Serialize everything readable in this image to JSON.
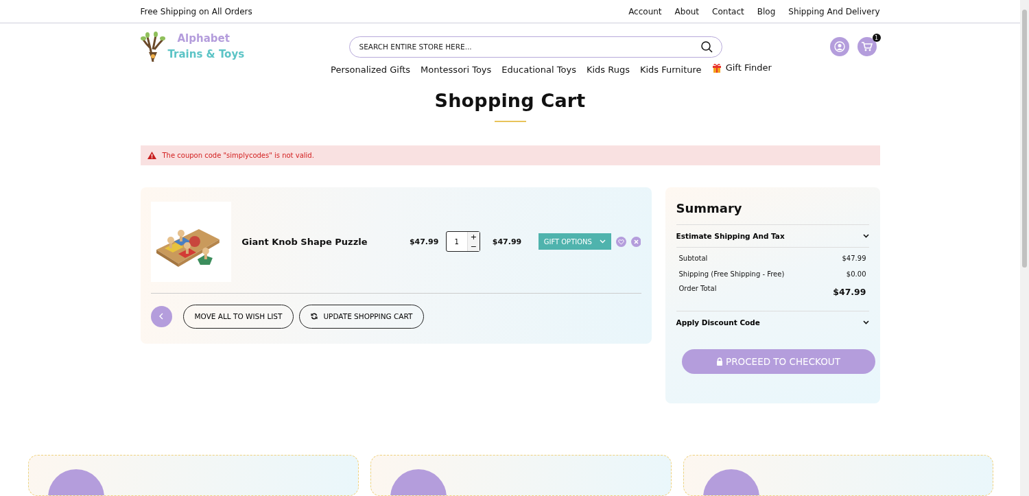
{
  "top_bar": {
    "promo": "Free Shipping on All Orders",
    "links": [
      "Account",
      "About",
      "Contact",
      "Blog",
      "Shipping And Delivery"
    ]
  },
  "header": {
    "logo": {
      "line1": "Alphabet",
      "line2": "Trains & Toys"
    },
    "search": {
      "placeholder": "SEARCH ENTIRE STORE HERE..."
    },
    "cart_count": "1"
  },
  "nav": [
    {
      "label": "Personalized Gifts",
      "kind": "plain"
    },
    {
      "label": "Montessori Toys",
      "kind": "plain"
    },
    {
      "label": "Educational Toys",
      "kind": "plain"
    },
    {
      "label": "Kids Rugs",
      "kind": "plain"
    },
    {
      "label": "Kids Furniture",
      "kind": "plain"
    },
    {
      "label": "Gift Finder",
      "kind": "gift"
    }
  ],
  "page_title": "Shopping Cart",
  "alert": "The coupon code \"simplycodes\" is not valid.",
  "cart": {
    "items": [
      {
        "name": "Giant Knob Shape Puzzle",
        "price": "$47.99",
        "qty": "1",
        "increase": "+",
        "decrease": "−",
        "subtotal": "$47.99",
        "gift_button": "GIFT OPTIONS"
      }
    ],
    "actions": [
      "MOVE ALL TO WISH LIST",
      "UPDATE SHOPPING CART"
    ]
  },
  "summary": {
    "title": "Summary",
    "sections": [
      {
        "label": "Estimate Shipping And Tax",
        "expanded": false
      },
      {
        "label": "Apply Discount Code",
        "expanded": false
      }
    ],
    "rows": [
      {
        "label": "Subtotal",
        "value": "$47.99",
        "kind": "normal"
      },
      {
        "label": "Shipping (Free Shipping - Free)",
        "value": "$0.00",
        "kind": "normal"
      },
      {
        "label": "Order Total",
        "value": "$47.99",
        "kind": "total"
      }
    ],
    "checkout": "PROCEED TO CHECKOUT"
  },
  "features": [
    {
      "kind": "card"
    },
    {
      "kind": "card"
    },
    {
      "kind": "card"
    }
  ]
}
